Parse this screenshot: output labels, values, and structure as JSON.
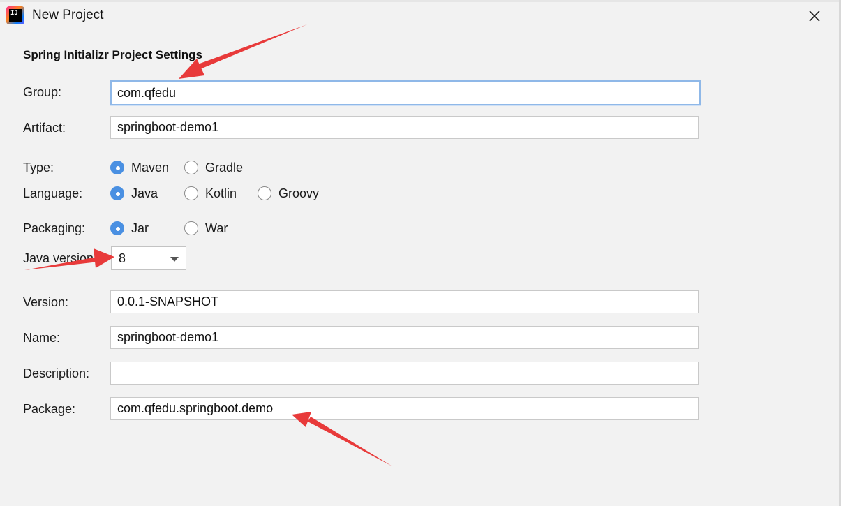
{
  "window": {
    "title": "New Project",
    "app_icon_text": "IJ"
  },
  "section": {
    "title": "Spring Initializr Project Settings"
  },
  "form": {
    "group": {
      "label": "Group:",
      "value": "com.qfedu"
    },
    "artifact": {
      "label": "Artifact:",
      "value": "springboot-demo1"
    },
    "type": {
      "label": "Type:",
      "options": [
        "Maven",
        "Gradle"
      ],
      "selected": "Maven"
    },
    "language": {
      "label": "Language:",
      "options": [
        "Java",
        "Kotlin",
        "Groovy"
      ],
      "selected": "Java"
    },
    "packaging": {
      "label": "Packaging:",
      "options": [
        "Jar",
        "War"
      ],
      "selected": "Jar"
    },
    "java_version": {
      "label": "Java version:",
      "value": "8"
    },
    "version": {
      "label": "Version:",
      "value": "0.0.1-SNAPSHOT"
    },
    "name": {
      "label": "Name:",
      "value": "springboot-demo1"
    },
    "description": {
      "label": "Description:",
      "value": ""
    },
    "package": {
      "label": "Package:",
      "value": "com.qfedu.springboot.demo"
    }
  },
  "colors": {
    "accent": "#4a90e2",
    "annotation_arrow": "#e83a3a",
    "background": "#f2f2f2"
  },
  "icons": {
    "app": "intellij-idea-icon",
    "close": "close-icon",
    "dropdown": "chevron-down-icon"
  }
}
